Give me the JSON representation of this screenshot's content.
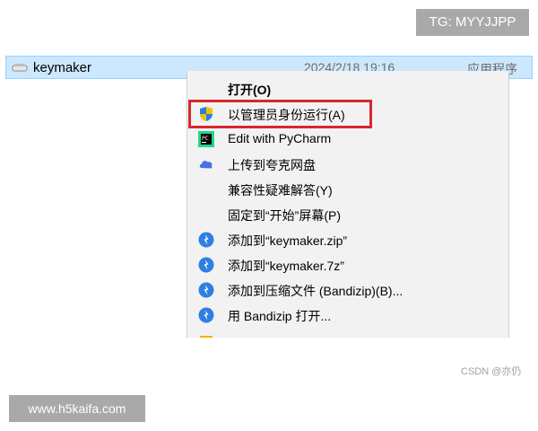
{
  "tg_badge": "TG: MYYJJPP",
  "file": {
    "name": "keymaker",
    "date": "2024/2/18 19:16",
    "type": "应用程序",
    "icon": "app-file-icon"
  },
  "menu": {
    "items": [
      {
        "label": "打开(O)",
        "icon": "",
        "bold": true
      },
      {
        "label": "以管理员身份运行(A)",
        "icon": "uac-shield-icon",
        "highlighted": true
      },
      {
        "label": "Edit with PyCharm",
        "icon": "pycharm-icon"
      },
      {
        "label": "上传到夸克网盘",
        "icon": "quark-cloud-icon"
      },
      {
        "label": "兼容性疑难解答(Y)",
        "icon": ""
      },
      {
        "label": "固定到“开始”屏幕(P)",
        "icon": ""
      },
      {
        "label": "添加到“keymaker.zip”",
        "icon": "bandizip-icon"
      },
      {
        "label": "添加到“keymaker.7z”",
        "icon": "bandizip-icon"
      },
      {
        "label": "添加到压缩文件 (Bandizip)(B)...",
        "icon": "bandizip-icon"
      },
      {
        "label": "用 Bandizip 打开...",
        "icon": "bandizip-icon"
      }
    ]
  },
  "highlight_color": "#d9262f",
  "watermark_csdn": "CSDN @亦仍",
  "watermark_site": "www.h5kaifa.com"
}
